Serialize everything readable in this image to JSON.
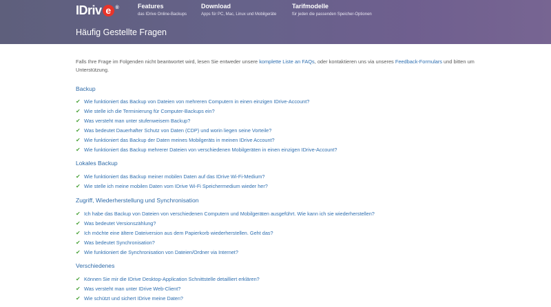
{
  "header": {
    "logo_text": "IDriv",
    "logo_e": "e",
    "logo_reg": "®",
    "nav": [
      {
        "title": "Features",
        "subtitle": "das IDrive Online-Backups"
      },
      {
        "title": "Download",
        "subtitle": "Apps für PC, Mac, Linux und Mobilgeräte"
      },
      {
        "title": "Tarifmodelle",
        "subtitle": "für jeden die passenden Speicher-Optionen"
      }
    ],
    "page_title": "Häufig Gestellte Fragen"
  },
  "intro": {
    "text_before": "Falls Ihre Frage im Folgenden nicht beantwortet wird, lesen Sie entweder unsere ",
    "link1": "komplette Liste an FAQs",
    "text_middle": ", oder kontaktieren uns via unseres ",
    "link2": "Feedback-Formulars",
    "text_after": " und bitten um Unterstützung."
  },
  "sections": [
    {
      "title": "Backup",
      "items": [
        "Wie funktioniert das Backup von Dateien von mehreren Computern in einen einzigen IDrive-Account?",
        "Wie stelle ich die Terminierung für Computer-Backups ein?",
        "Was versteht man unter stufenweisem Backup?",
        "Was bedeutet Dauerhafter Schutz von Daten (CDP) und worin liegen seine Vorteile?",
        "Wie funktioniert das Backup der Daten meines Mobilgeräts in meinen IDrive Account?",
        "Wie funktioniert das Backup mehrerer Dateien von verschiedenen Mobilgeräten in einen einzigen IDrive-Account?"
      ]
    },
    {
      "title": "Lokales Backup",
      "items": [
        "Wie funktioniert das Backup meiner mobilen Daten auf das IDrive Wi-Fi-Medium?",
        "Wie stelle ich meine mobilen Daten vom IDrive Wi-Fi Speichermedium wieder her?"
      ]
    },
    {
      "title": "Zugriff, Wiederherstellung und Synchronisation",
      "items": [
        "Ich habe das Backup von Dateien von verschiedenen Computern und Mobilgeräten ausgeführt. Wie kann ich sie wiederherstellen?",
        "Was bedeutet Versionszählung?",
        "Ich möchte eine ältere Dateiversion aus dem Papierkorb wiederherstellen. Geht das?",
        "Was bedeutet Synchronisation?",
        "Wie funktioniert die Synchronisation von Dateien/Ordner via Internet?"
      ]
    },
    {
      "title": "Verschiedenes",
      "items": [
        "Können Sie mir die IDrive Desktop-Application Schnittstelle detailliert erklären?",
        "Was versteht man unter IDrive Web-Client?",
        "Wie schützt und sichert IDrive meine Daten?"
      ]
    }
  ],
  "check_icon": "✔",
  "colors": {
    "header_start": "#5e5f7c",
    "header_end": "#776592",
    "link": "#2f6fb0",
    "section_title": "#2d6aa8",
    "check": "#4ca33b",
    "logo_accent": "#e8342a"
  }
}
